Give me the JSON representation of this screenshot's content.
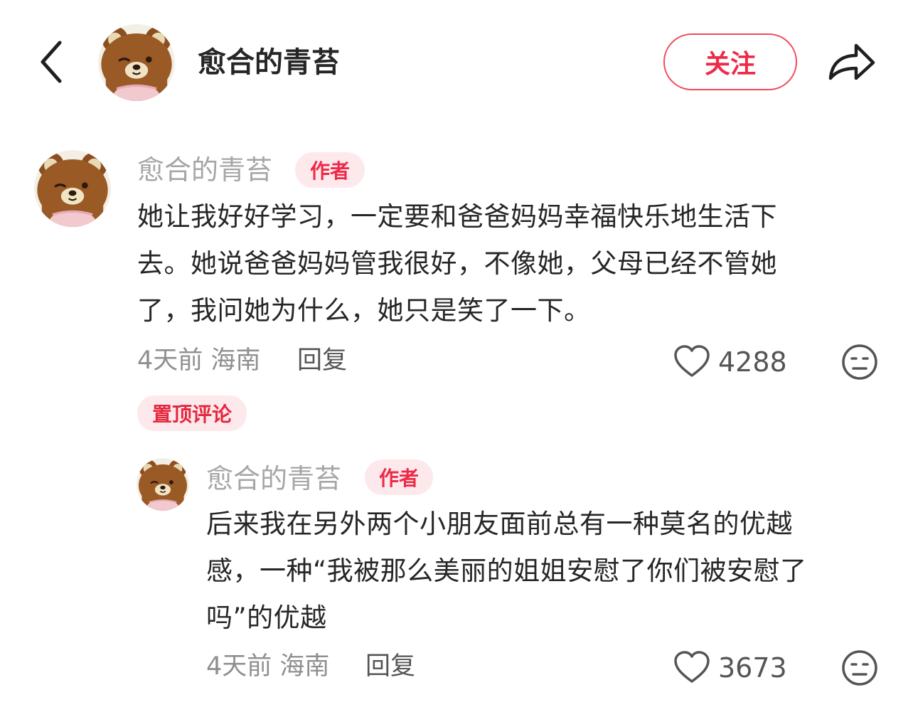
{
  "header": {
    "author_name": "愈合的青苔",
    "follow_label": "关注"
  },
  "comments": [
    {
      "author": "愈合的青苔",
      "author_tag": "作者",
      "text_lines": [
        "她让我好好学习，一定要和爸爸妈妈幸福快乐地生活下",
        "去。她说爸爸妈妈管我很好，不像她，父母已经不管她",
        "了，我问她为什么，她只是笑了一下。"
      ],
      "meta": "4天前 海南",
      "reply_label": "回复",
      "likes": "4288",
      "pinned_label": "置顶评论"
    },
    {
      "author": "愈合的青苔",
      "author_tag": "作者",
      "text_lines": [
        "后来我在另外两个小朋友面前总有一种莫名的优越",
        "感，一种“我被那么美丽的姐姐安慰了你们被安慰了",
        "吗”的优越"
      ],
      "meta": "4天前 海南",
      "reply_label": "回复",
      "likes": "3673"
    }
  ],
  "icons": {
    "back": "chevron-left-icon",
    "share": "share-arrow-icon",
    "like": "heart-outline-icon",
    "dislike": "meh-face-icon"
  },
  "colors": {
    "accent": "#ee2a48",
    "tag_bg": "#fde9ec",
    "muted_text": "#a6a6a6"
  }
}
